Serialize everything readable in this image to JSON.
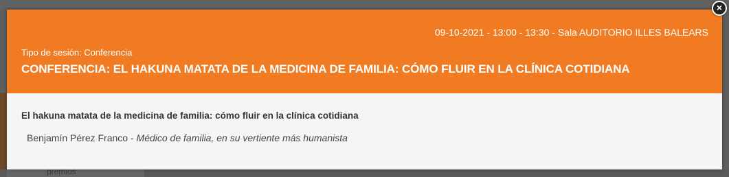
{
  "backdrop": {
    "ghost_text": "premios"
  },
  "modal": {
    "datetime_room": "09-10-2021 - 13:00 - 13:30 - Sala AUDITORIO ILLES BALEARS",
    "session_type": "Tipo de sesión: Conferencia",
    "session_title": "CONFERENCIA: EL HAKUNA MATATA DE LA MEDICINA DE FAMILIA: CÓMO FLUIR EN LA CLÍNICA COTIDIANA",
    "talk_title": "El hakuna matata de la medicina de familia: cómo fluir en la clínica cotidiana",
    "speaker_name": "Benjamín Pérez Franco",
    "speaker_separator": " - ",
    "speaker_role": "Médico de familia, en su vertiente más humanista",
    "close_label": "×",
    "close_icon": "close-icon"
  },
  "colors": {
    "header_bg": "#f07b22",
    "body_bg": "#f5f5f5",
    "overlay": "#5f5f5f"
  }
}
